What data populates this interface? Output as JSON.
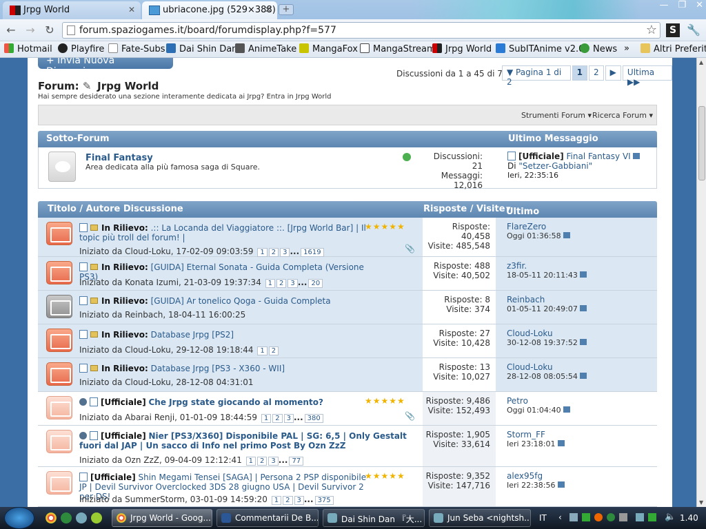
{
  "browser": {
    "tabs": [
      {
        "label": "Jrpg World",
        "active": false
      },
      {
        "label": "ubriacone.jpg (529×388)",
        "active": true
      }
    ],
    "url": "forum.spaziogames.it/board/forumdisplay.php?f=577",
    "bookmarks": [
      "Hotmail",
      "Playfire",
      "Fate-Subs",
      "Dai Shin Dan",
      "AnimeTake",
      "MangaFox",
      "MangaStream",
      "Jrpg World",
      "SubITAnime v2.0",
      "News",
      "Altri Preferiti"
    ],
    "more_chevron": "»"
  },
  "forum": {
    "new_thread_button": "+ Invia Nuova Discussione",
    "page_info": "Discussioni da 1 a 45 di 73",
    "pager": {
      "label": "▼ Pagina 1 di 2",
      "pages": [
        "1",
        "2"
      ],
      "current": "1",
      "next": "▶",
      "last": "Ultima ▶▶"
    },
    "title_prefix": "Forum:",
    "title": "Jrpg World",
    "description": "Hai sempre desiderato una sezione interamente dedicata ai Jrpg? Entra in Jrpg World",
    "tools": {
      "forum_tools": "Strumenti Forum ▾",
      "search_forum": "Ricerca Forum ▾"
    }
  },
  "subforum_header": {
    "left": "Sotto-Forum",
    "right": "Ultimo Messaggio"
  },
  "subforum": {
    "name": "Final Fantasy",
    "desc": "Area dedicata alla più famosa saga di Square.",
    "discussions": "Discussioni: 21",
    "messages_label": "Messaggi:",
    "messages": "12,016",
    "last_tag": "[Ufficiale]",
    "last_title": "Final Fantasy VI",
    "last_by_prefix": "Di",
    "last_by": "\"Setzer-Gabbiani\"",
    "last_time": "Ieri, 22:35:16"
  },
  "threads_header": {
    "title": "Titolo / Autore Discussione",
    "stats": "Risposte / Visite",
    "last": "Ultimo Messaggio Di"
  },
  "threads": [
    {
      "prefix": "In Rilievo:",
      "title": ".:: La Locanda del Viaggiatore ::. [Jrpg World Bar] | Il topic più troll del forum! |",
      "by": "Iniziato da Cloud-Loku, 17-02-09 09:03:59",
      "pages": [
        "1",
        "2",
        "3",
        "...",
        "1619"
      ],
      "replies": "Risposte: 40,458",
      "views": "Visite: 485,548",
      "last_user": "FlareZero",
      "last_time": "Oggi 01:36:58",
      "stars": "★★★★★"
    },
    {
      "prefix": "In Rilievo:",
      "title": "[GUIDA] Eternal Sonata - Guida Completa (Versione PS3)",
      "by": "Iniziato da Konata Izumi, 21-03-09 19:37:34",
      "pages": [
        "1",
        "2",
        "3",
        "...",
        "20"
      ],
      "replies": "Risposte: 488",
      "views": "Visite: 40,502",
      "last_user": "z3fir.",
      "last_time": "18-05-11 20:11:43"
    },
    {
      "prefix": "In Rilievo:",
      "title": "[GUIDA] Ar tonelico Qoga - Guida Completa",
      "by": "Iniziato da Reinbach, 18-04-11 16:00:25",
      "pages": [],
      "replies": "Risposte: 8",
      "views": "Visite: 374",
      "last_user": "Reinbach",
      "last_time": "01-05-11 20:49:07"
    },
    {
      "prefix": "In Rilievo:",
      "title": "Database Jrpg [PS2]",
      "by": "Iniziato da Cloud-Loku, 29-12-08 19:18:44",
      "pages": [
        "1",
        "2"
      ],
      "replies": "Risposte: 27",
      "views": "Visite: 10,428",
      "last_user": "Cloud-Loku",
      "last_time": "30-12-08 19:37:52"
    },
    {
      "prefix": "In Rilievo:",
      "title": "Database Jrpg [PS3 - X360 - WII]",
      "by": "Iniziato da Cloud-Loku, 28-12-08 04:31:01",
      "pages": [],
      "replies": "Risposte: 13",
      "views": "Visite: 10,027",
      "last_user": "Cloud-Loku",
      "last_time": "28-12-08 08:05:54"
    },
    {
      "prefix": "[Ufficiale]",
      "title": "Che Jrpg state giocando al momento?",
      "by": "Iniziato da Abarai Renji, 01-01-09 18:44:59",
      "pages": [
        "1",
        "2",
        "3",
        "...",
        "380"
      ],
      "replies": "Risposte: 9,486",
      "views": "Visite: 152,493",
      "last_user": "Petro",
      "last_time": "Oggi 01:04:40",
      "stars": "★★★★★"
    },
    {
      "prefix": "[Ufficiale]",
      "title": "Nier [PS3/X360] Disponibile PAL | SG: 6,5 | Only Gestalt fuori dal JAP | Un sacco di Info nel primo Post By Ozn ZzZ",
      "by": "Iniziato da Ozn ZzZ, 09-04-09 12:12:41",
      "pages": [
        "1",
        "2",
        "3",
        "...",
        "77"
      ],
      "replies": "Risposte: 1,905",
      "views": "Visite: 33,614",
      "last_user": "Storm_FF",
      "last_time": "Ieri 23:18:01"
    },
    {
      "prefix": "[Ufficiale]",
      "title": "Shin Megami Tensei [SAGA] | Persona 2 PSP disponibile JP | Devil Survivor Overclocked 3DS 28 giugno USA | Devil Survivor 2 per DS!",
      "by": "Iniziato da SummerStorm, 03-01-09 14:59:20",
      "pages": [
        "1",
        "2",
        "3",
        "...",
        "375"
      ],
      "replies": "Risposte: 9,352",
      "views": "Visite: 147,716",
      "last_user": "alex95fg",
      "last_time": "Ieri 22:38:56",
      "stars": "★★★★★"
    }
  ],
  "taskbar": {
    "items": [
      "Jrpg World - Goog...",
      "Commentarii De B...",
      "Dai Shin Dan 『大...",
      "Jun Seba <nightsh..."
    ],
    "lang": "IT",
    "clock": "1.40"
  }
}
